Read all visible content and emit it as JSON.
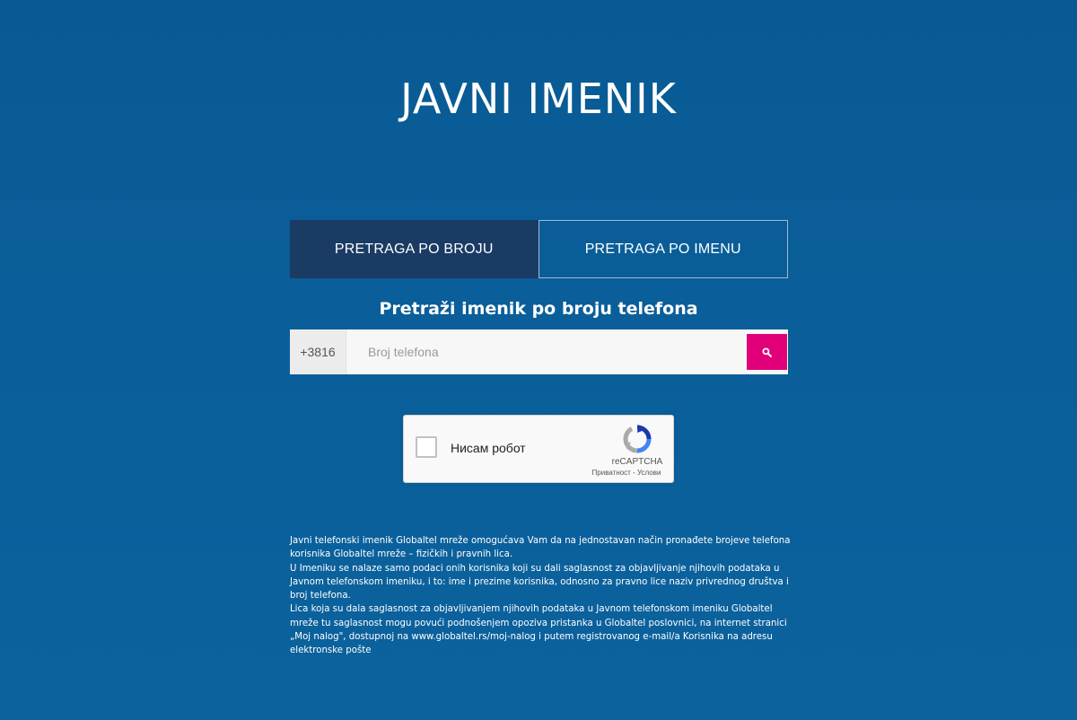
{
  "title": "JAVNI IMENIK",
  "tabs": [
    {
      "label": "PRETRAGA PO BROJU",
      "active": true
    },
    {
      "label": "PRETRAGA PO IMENU",
      "active": false
    }
  ],
  "search": {
    "heading": "Pretraži imenik po broju telefona",
    "prefix": "+3816",
    "placeholder": "Broj telefona",
    "value": "",
    "button_icon": "search-icon"
  },
  "recaptcha": {
    "label": "Нисам робот",
    "brand": "reCAPTCHA",
    "privacy": "Приватност",
    "separator": " - ",
    "terms": "Услови"
  },
  "info": {
    "paragraphs": [
      "Javni telefonski imenik Globaltel mreže omogućava Vam da na jednostavan način pronađete brojeve telefona korisnika Globaltel mreže – fizičkih i pravnih lica.",
      "U Imeniku se nalaze samo podaci onih korisnika koji su dali saglasnost za objavljivanje njihovih podataka u Javnom telefonskom imeniku, i to: ime i prezime korisnika, odnosno za pravno lice naziv privrednog društva i broj telefona.",
      "Lica koja su dala saglasnost za objavljivanjem njihovih podataka u Javnom telefonskom imeniku Globaltel mreže tu saglasnost mogu povući podnošenjem opoziva pristanka u Globaltel poslovnici, na internet stranici „Moj nalog\", dostupnoj na www.globaltel.rs/moj-nalog i putem registrovanog e-mail/a Korisnika na adresu elektronske pošte"
    ]
  },
  "colors": {
    "background": "#0a5e99",
    "active_tab": "#1a3c64",
    "search_button": "#e2007a"
  }
}
